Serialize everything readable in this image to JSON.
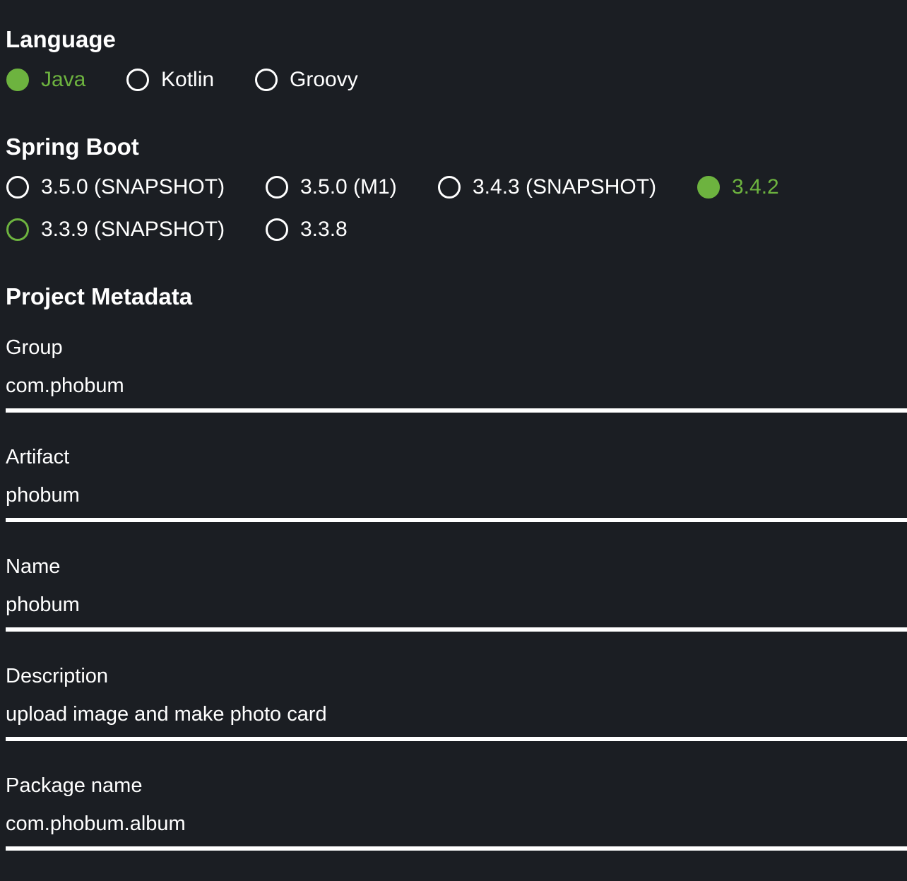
{
  "language": {
    "title": "Language",
    "options": [
      {
        "label": "Java",
        "checked": true
      },
      {
        "label": "Kotlin",
        "checked": false
      },
      {
        "label": "Groovy",
        "checked": false
      }
    ]
  },
  "spring_boot": {
    "title": "Spring Boot",
    "options": [
      {
        "label": "3.5.0 (SNAPSHOT)",
        "checked": false
      },
      {
        "label": "3.5.0 (M1)",
        "checked": false
      },
      {
        "label": "3.4.3 (SNAPSHOT)",
        "checked": false
      },
      {
        "label": "3.4.2",
        "checked": true
      },
      {
        "label": "3.3.9 (SNAPSHOT)",
        "checked": false,
        "hovered": true
      },
      {
        "label": "3.3.8",
        "checked": false
      }
    ]
  },
  "metadata": {
    "title": "Project Metadata",
    "fields": [
      {
        "label": "Group",
        "value": "com.phobum"
      },
      {
        "label": "Artifact",
        "value": "phobum"
      },
      {
        "label": "Name",
        "value": "phobum"
      },
      {
        "label": "Description",
        "value": "upload image and make photo card"
      },
      {
        "label": "Package name",
        "value": "com.phobum.album"
      }
    ]
  },
  "colors": {
    "background": "#1b1e23",
    "accent": "#6db33f",
    "text": "#ffffff"
  }
}
